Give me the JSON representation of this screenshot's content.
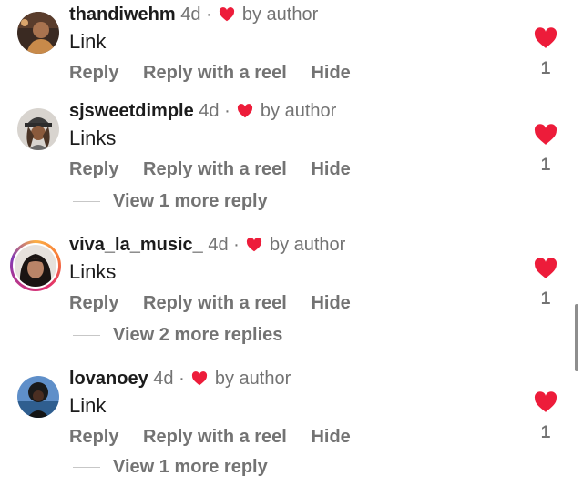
{
  "comments": [
    {
      "username": "thandiwehm",
      "age": "4d",
      "separator": "·",
      "by_author": "by author",
      "text": "Link",
      "actions": [
        "Reply",
        "Reply with a reel",
        "Hide"
      ],
      "like_count": "1",
      "more_replies": null
    },
    {
      "username": "sjsweetdimple",
      "age": "4d",
      "separator": "·",
      "by_author": "by author",
      "text": "Links",
      "actions": [
        "Reply",
        "Reply with a reel",
        "Hide"
      ],
      "like_count": "1",
      "more_replies": "View 1 more reply"
    },
    {
      "username": "viva_la_music_",
      "age": "4d",
      "separator": "·",
      "by_author": "by author",
      "text": "Links",
      "actions": [
        "Reply",
        "Reply with a reel",
        "Hide"
      ],
      "like_count": "1",
      "more_replies": "View 2 more replies"
    },
    {
      "username": "lovanoey",
      "age": "4d",
      "separator": "·",
      "by_author": "by author",
      "text": "Link",
      "actions": [
        "Reply",
        "Reply with a reel",
        "Hide"
      ],
      "like_count": "1",
      "more_replies": "View 1 more reply"
    }
  ],
  "colors": {
    "heart": "#ed1c3a",
    "meta_gray": "#737373",
    "text": "#1c1c1c"
  },
  "icons": {
    "author_like": "heart-icon",
    "like_button": "heart-icon"
  }
}
